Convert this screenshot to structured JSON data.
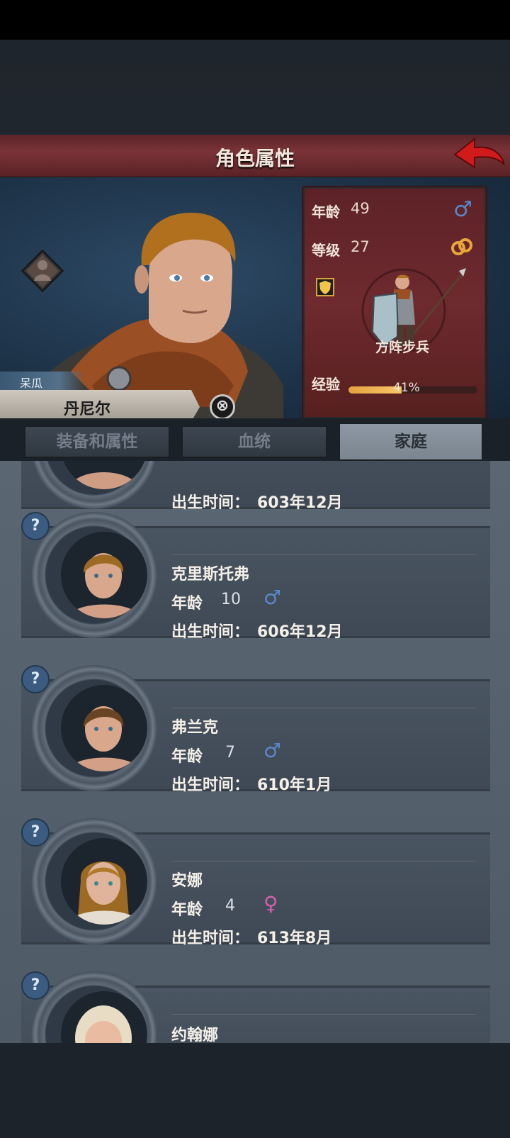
{
  "header": {
    "title": "角色属性"
  },
  "character": {
    "nickname": "呆瓜",
    "name": "丹尼尔",
    "dismiss_symbol": "⊗"
  },
  "stats": {
    "age_label": "年龄",
    "age": "49",
    "gender_icon": "male-icon",
    "level_label": "等级",
    "level": "27",
    "status_icon": "married-rings-icon",
    "trait_icon": "shield-badge-icon",
    "unit_type": "方阵步兵",
    "xp_label": "经验",
    "xp_percent": "41%",
    "xp_fraction": 0.41
  },
  "tabs": [
    {
      "label": "装备和属性",
      "active": false
    },
    {
      "label": "血统",
      "active": false
    },
    {
      "label": "家庭",
      "active": true
    }
  ],
  "family": {
    "age_label": "年龄",
    "birth_label": "出生时间：",
    "members": [
      {
        "name": "",
        "age": "",
        "gender": "",
        "birth": "603年12月"
      },
      {
        "name": "克里斯托弗",
        "age": "10",
        "gender": "♂",
        "birth": "606年12月"
      },
      {
        "name": "弗兰克",
        "age": "7",
        "gender": "♂",
        "birth": "610年1月"
      },
      {
        "name": "安娜",
        "age": "4",
        "gender": "♀",
        "birth": "613年8月"
      },
      {
        "name": "约翰娜",
        "age": "",
        "gender": "",
        "birth": ""
      }
    ],
    "unknown_symbol": "?"
  },
  "colors": {
    "title_bar": "#7a3338",
    "stats_panel": "#6e2a2f",
    "male": "#5b86c9",
    "female": "#d860a8",
    "xp": "#f0b050"
  }
}
